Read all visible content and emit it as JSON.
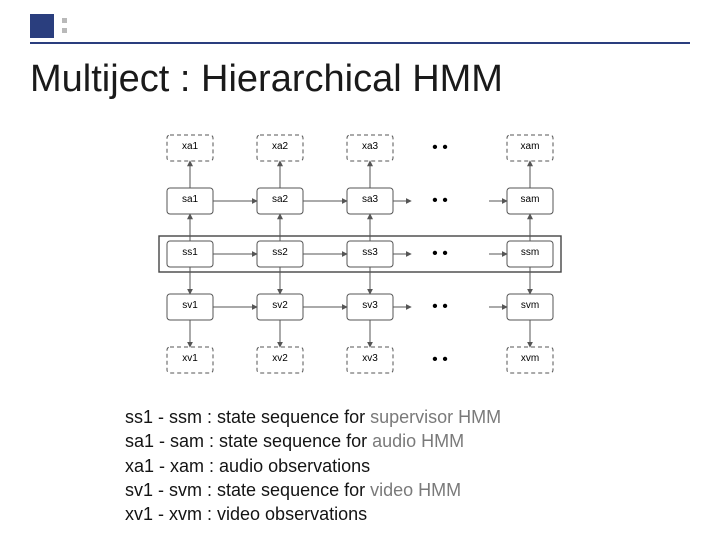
{
  "accent_color": "#2a3e7e",
  "title": "Multiject : Hierarchical HMM",
  "diagram": {
    "rows": [
      {
        "id": "xa",
        "style": "dashed",
        "labels": [
          "xa1",
          "xa2",
          "xa3",
          "xam"
        ]
      },
      {
        "id": "sa",
        "style": "solid",
        "labels": [
          "sa1",
          "sa2",
          "sa3",
          "sam"
        ]
      },
      {
        "id": "ss",
        "style": "solid",
        "labels": [
          "ss1",
          "ss2",
          "ss3",
          "ssm"
        ],
        "boxed": true
      },
      {
        "id": "sv",
        "style": "solid",
        "labels": [
          "sv1",
          "sv2",
          "sv3",
          "svm"
        ]
      },
      {
        "id": "xv",
        "style": "dashed",
        "labels": [
          "xv1",
          "xv2",
          "xv3",
          "xvm"
        ]
      }
    ],
    "ellipsis": "•  •"
  },
  "legend": [
    {
      "lhs": "ss1 - ssm",
      "mid": " : state sequence for ",
      "hl": "supervisor HMM"
    },
    {
      "lhs": "sa1 - sam",
      "mid": " : state sequence for ",
      "hl": "audio HMM"
    },
    {
      "lhs": "xa1 - xam",
      "mid": " : audio observations",
      "hl": ""
    },
    {
      "lhs": "sv1 - svm",
      "mid": " : state sequence for ",
      "hl": "video HMM"
    },
    {
      "lhs": "xv1 - xvm",
      "mid": " : video observations",
      "hl": ""
    }
  ]
}
